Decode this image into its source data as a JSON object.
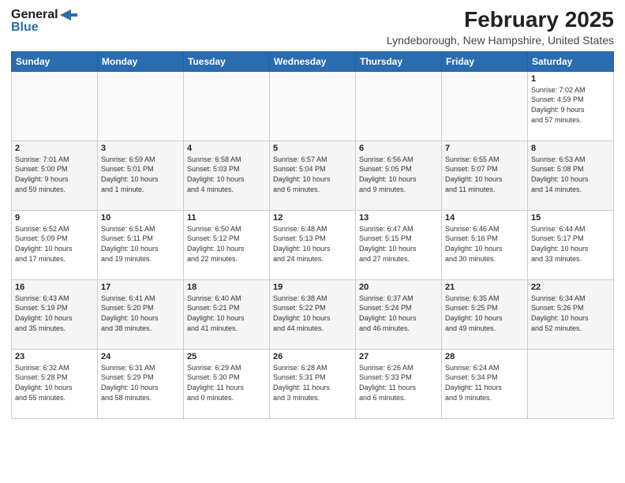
{
  "header": {
    "logo_general": "General",
    "logo_blue": "Blue",
    "month_title": "February 2025",
    "location": "Lyndeborough, New Hampshire, United States"
  },
  "days_of_week": [
    "Sunday",
    "Monday",
    "Tuesday",
    "Wednesday",
    "Thursday",
    "Friday",
    "Saturday"
  ],
  "weeks": [
    [
      {
        "day": "",
        "info": ""
      },
      {
        "day": "",
        "info": ""
      },
      {
        "day": "",
        "info": ""
      },
      {
        "day": "",
        "info": ""
      },
      {
        "day": "",
        "info": ""
      },
      {
        "day": "",
        "info": ""
      },
      {
        "day": "1",
        "info": "Sunrise: 7:02 AM\nSunset: 4:59 PM\nDaylight: 9 hours\nand 57 minutes."
      }
    ],
    [
      {
        "day": "2",
        "info": "Sunrise: 7:01 AM\nSunset: 5:00 PM\nDaylight: 9 hours\nand 59 minutes."
      },
      {
        "day": "3",
        "info": "Sunrise: 6:59 AM\nSunset: 5:01 PM\nDaylight: 10 hours\nand 1 minute."
      },
      {
        "day": "4",
        "info": "Sunrise: 6:58 AM\nSunset: 5:03 PM\nDaylight: 10 hours\nand 4 minutes."
      },
      {
        "day": "5",
        "info": "Sunrise: 6:57 AM\nSunset: 5:04 PM\nDaylight: 10 hours\nand 6 minutes."
      },
      {
        "day": "6",
        "info": "Sunrise: 6:56 AM\nSunset: 5:05 PM\nDaylight: 10 hours\nand 9 minutes."
      },
      {
        "day": "7",
        "info": "Sunrise: 6:55 AM\nSunset: 5:07 PM\nDaylight: 10 hours\nand 11 minutes."
      },
      {
        "day": "8",
        "info": "Sunrise: 6:53 AM\nSunset: 5:08 PM\nDaylight: 10 hours\nand 14 minutes."
      }
    ],
    [
      {
        "day": "9",
        "info": "Sunrise: 6:52 AM\nSunset: 5:09 PM\nDaylight: 10 hours\nand 17 minutes."
      },
      {
        "day": "10",
        "info": "Sunrise: 6:51 AM\nSunset: 5:11 PM\nDaylight: 10 hours\nand 19 minutes."
      },
      {
        "day": "11",
        "info": "Sunrise: 6:50 AM\nSunset: 5:12 PM\nDaylight: 10 hours\nand 22 minutes."
      },
      {
        "day": "12",
        "info": "Sunrise: 6:48 AM\nSunset: 5:13 PM\nDaylight: 10 hours\nand 24 minutes."
      },
      {
        "day": "13",
        "info": "Sunrise: 6:47 AM\nSunset: 5:15 PM\nDaylight: 10 hours\nand 27 minutes."
      },
      {
        "day": "14",
        "info": "Sunrise: 6:46 AM\nSunset: 5:16 PM\nDaylight: 10 hours\nand 30 minutes."
      },
      {
        "day": "15",
        "info": "Sunrise: 6:44 AM\nSunset: 5:17 PM\nDaylight: 10 hours\nand 33 minutes."
      }
    ],
    [
      {
        "day": "16",
        "info": "Sunrise: 6:43 AM\nSunset: 5:19 PM\nDaylight: 10 hours\nand 35 minutes."
      },
      {
        "day": "17",
        "info": "Sunrise: 6:41 AM\nSunset: 5:20 PM\nDaylight: 10 hours\nand 38 minutes."
      },
      {
        "day": "18",
        "info": "Sunrise: 6:40 AM\nSunset: 5:21 PM\nDaylight: 10 hours\nand 41 minutes."
      },
      {
        "day": "19",
        "info": "Sunrise: 6:38 AM\nSunset: 5:22 PM\nDaylight: 10 hours\nand 44 minutes."
      },
      {
        "day": "20",
        "info": "Sunrise: 6:37 AM\nSunset: 5:24 PM\nDaylight: 10 hours\nand 46 minutes."
      },
      {
        "day": "21",
        "info": "Sunrise: 6:35 AM\nSunset: 5:25 PM\nDaylight: 10 hours\nand 49 minutes."
      },
      {
        "day": "22",
        "info": "Sunrise: 6:34 AM\nSunset: 5:26 PM\nDaylight: 10 hours\nand 52 minutes."
      }
    ],
    [
      {
        "day": "23",
        "info": "Sunrise: 6:32 AM\nSunset: 5:28 PM\nDaylight: 10 hours\nand 55 minutes."
      },
      {
        "day": "24",
        "info": "Sunrise: 6:31 AM\nSunset: 5:29 PM\nDaylight: 10 hours\nand 58 minutes."
      },
      {
        "day": "25",
        "info": "Sunrise: 6:29 AM\nSunset: 5:30 PM\nDaylight: 11 hours\nand 0 minutes."
      },
      {
        "day": "26",
        "info": "Sunrise: 6:28 AM\nSunset: 5:31 PM\nDaylight: 11 hours\nand 3 minutes."
      },
      {
        "day": "27",
        "info": "Sunrise: 6:26 AM\nSunset: 5:33 PM\nDaylight: 11 hours\nand 6 minutes."
      },
      {
        "day": "28",
        "info": "Sunrise: 6:24 AM\nSunset: 5:34 PM\nDaylight: 11 hours\nand 9 minutes."
      },
      {
        "day": "",
        "info": ""
      }
    ]
  ]
}
